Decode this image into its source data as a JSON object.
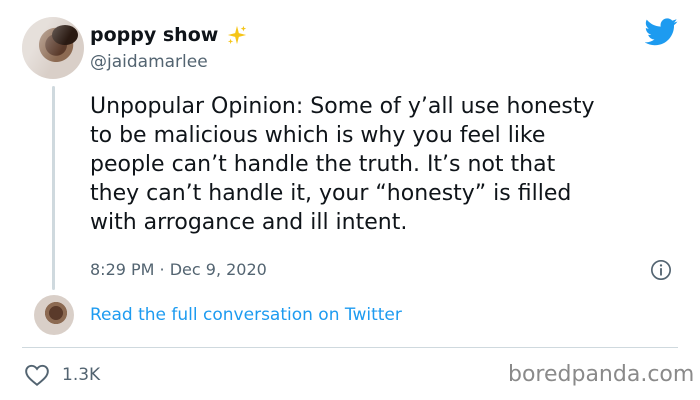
{
  "tweet": {
    "display_name": "poppy show",
    "handle": "@jaidamarlee",
    "lines": [
      "Unpopular Opinion: Some of y’all use honesty",
      "to be malicious which is why you feel like",
      "people can’t handle the truth. It’s not that",
      "they can’t handle it, your “honesty” is filled",
      "with arrogance and ill intent."
    ],
    "timestamp": "8:29 PM · Dec 9, 2020",
    "read_more": "Read the full conversation on Twitter",
    "likes": "1.3K"
  },
  "watermark": "boredpanda.com",
  "icons": {
    "badge": "sparkles-icon",
    "brand": "twitter-bird-icon",
    "info": "info-icon",
    "like": "heart-icon"
  },
  "colors": {
    "link": "#1d9bf0",
    "muted": "#536471",
    "brand": "#1d9bf0",
    "sparkle": "#f5c518"
  }
}
